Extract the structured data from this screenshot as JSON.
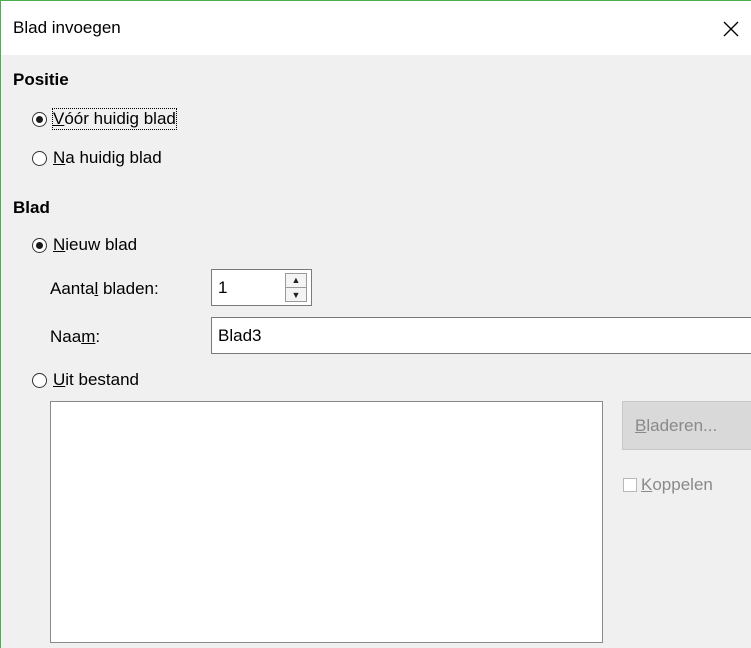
{
  "dialog": {
    "title": "Blad invoegen",
    "close_icon": "close-icon"
  },
  "position": {
    "heading": "Positie",
    "before_pre": "",
    "before_mnemonic": "V",
    "before_rest": "óór huidig blad",
    "before_checked": true,
    "after_pre": "",
    "after_mnemonic": "N",
    "after_rest": "a huidig blad",
    "after_checked": false
  },
  "sheet": {
    "heading": "Blad",
    "new_mnemonic": "N",
    "new_rest": "ieuw blad",
    "new_checked": true,
    "count_label_pre": "Aanta",
    "count_label_mnemonic": "l",
    "count_label_post": " bladen:",
    "count_value": "1",
    "name_label_pre": "Naa",
    "name_label_mnemonic": "m",
    "name_label_post": ":",
    "name_value": "Blad3",
    "from_file_mnemonic": "U",
    "from_file_rest": "it bestand",
    "from_file_checked": false,
    "browse_mnemonic": "B",
    "browse_rest": "laderen...",
    "link_mnemonic": "K",
    "link_rest": "oppelen",
    "link_checked": false
  },
  "colors": {
    "window_border": "#4caf50",
    "dialog_bg": "#f0f0f0",
    "disabled_text": "#8a8a8a"
  }
}
